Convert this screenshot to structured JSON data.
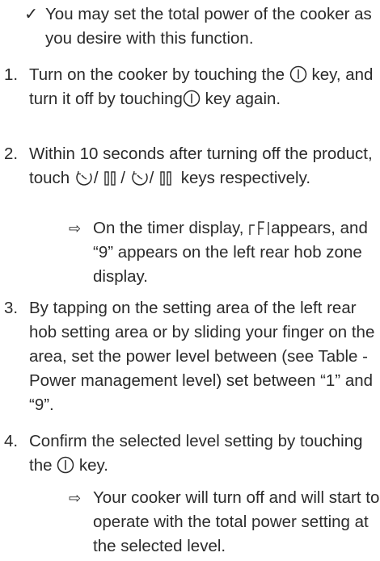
{
  "intro": {
    "mark": "✓",
    "text": "You may set the total power of the cooker as you desire with this function."
  },
  "steps": [
    {
      "number": "1.",
      "part1": "Turn on the cooker by touching the",
      "part2": "key, and turn it off by touching",
      "part3": "key again."
    },
    {
      "number": "2.",
      "part1": "Within 10 seconds after turning off the product, touch",
      "part2": "keys respectively."
    },
    {
      "number": "3.",
      "text": "By tapping on the setting area of the left rear hob setting area or by sliding your finger on the area, set the power level between (see Table - Power management level) set between “1” and “9”."
    },
    {
      "number": "4.",
      "part1": "Confirm the selected level setting by touching the",
      "part2": "key."
    }
  ],
  "results": [
    {
      "arrow": "⇨",
      "part1": "On the timer display,",
      "part2": "appears, and “9” appears on the left rear hob zone display."
    },
    {
      "arrow": "⇨",
      "text": "Your cooker will turn off and will start to operate with the total power setting at the selected level."
    }
  ],
  "icons": {
    "power": "power-key-icon",
    "timer": "timer-key-icon",
    "pause": "pause-key-icon",
    "cf_segment": "cf-segment-display-icon"
  }
}
